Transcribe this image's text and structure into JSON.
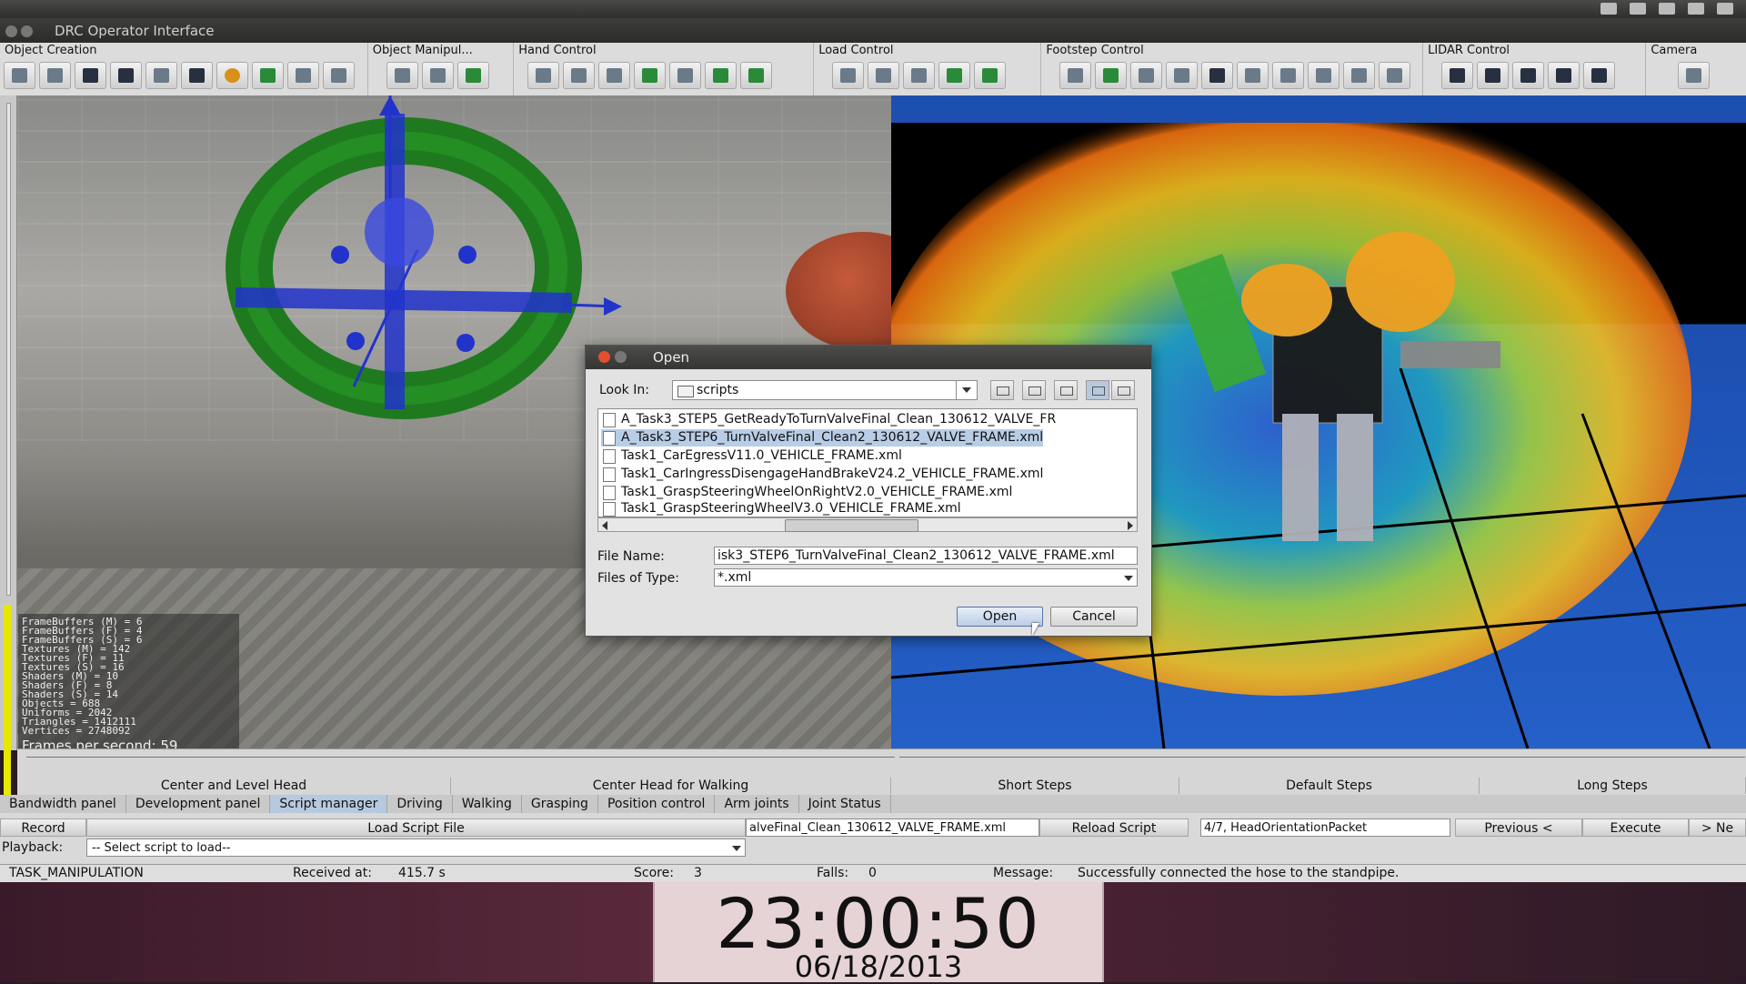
{
  "window": {
    "title": "DRC Operator Interface"
  },
  "toolbar": {
    "groups": [
      {
        "label": "Object Creation"
      },
      {
        "label": "Object Manipul..."
      },
      {
        "label": "Hand Control"
      },
      {
        "label": "Load Control"
      },
      {
        "label": "Footstep Control"
      },
      {
        "label": "LIDAR Control"
      },
      {
        "label": "Camera"
      }
    ]
  },
  "stats": {
    "lines": [
      "FrameBuffers (M) = 6",
      "FrameBuffers (F) = 4",
      "FrameBuffers (S) = 6",
      "Textures (M) = 142",
      "Textures (F) = 11",
      "Textures (S) = 16",
      "Shaders (M) = 10",
      "Shaders (F) = 8",
      "Shaders (S) = 14",
      "Objects = 688",
      "Uniforms = 2042",
      "Triangles = 1412111",
      "Vertices = 2748092"
    ],
    "fps": "Frames per second: 59"
  },
  "presets": {
    "left": [
      "Center and Level Head",
      "Center Head for Walking"
    ],
    "right": [
      "Short Steps",
      "Default Steps",
      "Long Steps"
    ]
  },
  "tabs": [
    "Bandwidth panel",
    "Development panel",
    "Script manager",
    "Driving",
    "Walking",
    "Grasping",
    "Position control",
    "Arm joints",
    "Joint Status"
  ],
  "active_tab": "Script manager",
  "panel": {
    "record": "Record",
    "load_script": "Load Script File",
    "loaded_file": "alveFinal_Clean_130612_VALVE_FRAME.xml",
    "reload": "Reload Script",
    "packet": "4/7, HeadOrientationPacket",
    "previous": "Previous <",
    "execute": "Execute",
    "next": "> Ne",
    "playback_label": "Playback:",
    "playback_value": "-- Select script to load--"
  },
  "status": {
    "task": "TASK_MANIPULATION",
    "received_label": "Received at:",
    "received_value": "415.7 s",
    "score_label": "Score:",
    "score_value": "3",
    "falls_label": "Falls:",
    "falls_value": "0",
    "message_label": "Message:",
    "message_value": "Successfully connected the hose to the standpipe."
  },
  "clock": {
    "time": "23:00:50",
    "date": "06/18/2013"
  },
  "dialog": {
    "title": "Open",
    "look_in_label": "Look In:",
    "look_in_value": "scripts",
    "files": [
      "A_Task3_STEP5_GetReadyToTurnValveFinal_Clean_130612_VALVE_FR",
      "A_Task3_STEP6_TurnValveFinal_Clean2_130612_VALVE_FRAME.xml",
      "Task1_CarEgressV11.0_VEHICLE_FRAME.xml",
      "Task1_CarIngressDisengageHandBrakeV24.2_VEHICLE_FRAME.xml",
      "Task1_GraspSteeringWheelOnRightV2.0_VEHICLE_FRAME.xml",
      "Task1_GraspSteeringWheelV3.0_VEHICLE_FRAME.xml"
    ],
    "selected_index": 1,
    "file_name_label": "File Name:",
    "file_name_value": "isk3_STEP6_TurnValveFinal_Clean2_130612_VALVE_FRAME.xml",
    "files_of_type_label": "Files of Type:",
    "files_of_type_value": "*.xml",
    "open": "Open",
    "cancel": "Cancel"
  },
  "colors": {
    "selection": "#b8cde6",
    "active_tab": "#b7c9df",
    "gizmo": "#2233cc",
    "ring": "#1f8a1f"
  }
}
